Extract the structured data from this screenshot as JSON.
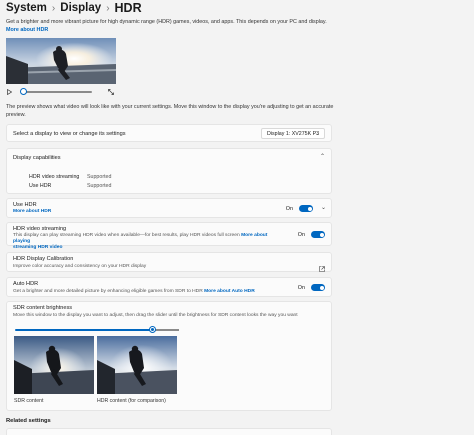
{
  "breadcrumb": {
    "items": [
      "System",
      "Display"
    ],
    "current": "HDR",
    "separator": "›"
  },
  "intro": {
    "text": "Get a brighter and more vibrant picture for high dynamic range (HDR) games, videos, and apps. This depends on your PC and display. ",
    "link": "More about HDR"
  },
  "preview_note": "The preview shows what video will look like with your current settings. Move this window to the display you're adjusting to get an accurate preview.",
  "display_select": {
    "label": "Select a display to view or change its settings",
    "value": "Display 1: XV275K P3"
  },
  "capabilities": {
    "title": "Display capabilities",
    "rows": [
      {
        "key": "HDR video streaming",
        "value": "Supported"
      },
      {
        "key": "Use HDR",
        "value": "Supported"
      }
    ]
  },
  "use_hdr": {
    "title": "Use HDR",
    "link": "More about HDR",
    "state": "On"
  },
  "hdr_video": {
    "title": "HDR video streaming",
    "desc": "This display can play streaming HDR video when available—for best results, play HDR videos full screen ",
    "link1": "More about playing",
    "link2": "streaming HDR video",
    "state": "On"
  },
  "calibration": {
    "title": "HDR Display Calibration",
    "desc": "Improve color accuracy and consistency on your HDR display"
  },
  "auto_hdr": {
    "title": "Auto HDR",
    "desc": "Get a brighter and more detailed picture by enhancing eligible games from SDR to HDR ",
    "link": "More about Auto HDR",
    "state": "On"
  },
  "sdr_brightness": {
    "title": "SDR content brightness",
    "desc": "Move this window to the display you want to adjust, then drag the slider until the brightness for SDR content looks the way you want",
    "level_fraction": 0.84,
    "sdr_label": "SDR content",
    "hdr_label": "HDR content (for comparison)"
  },
  "related": {
    "title": "Related settings"
  },
  "colors": {
    "accent": "#0067c0",
    "background": "#f3f3f3",
    "card": "#fbfbfb"
  }
}
